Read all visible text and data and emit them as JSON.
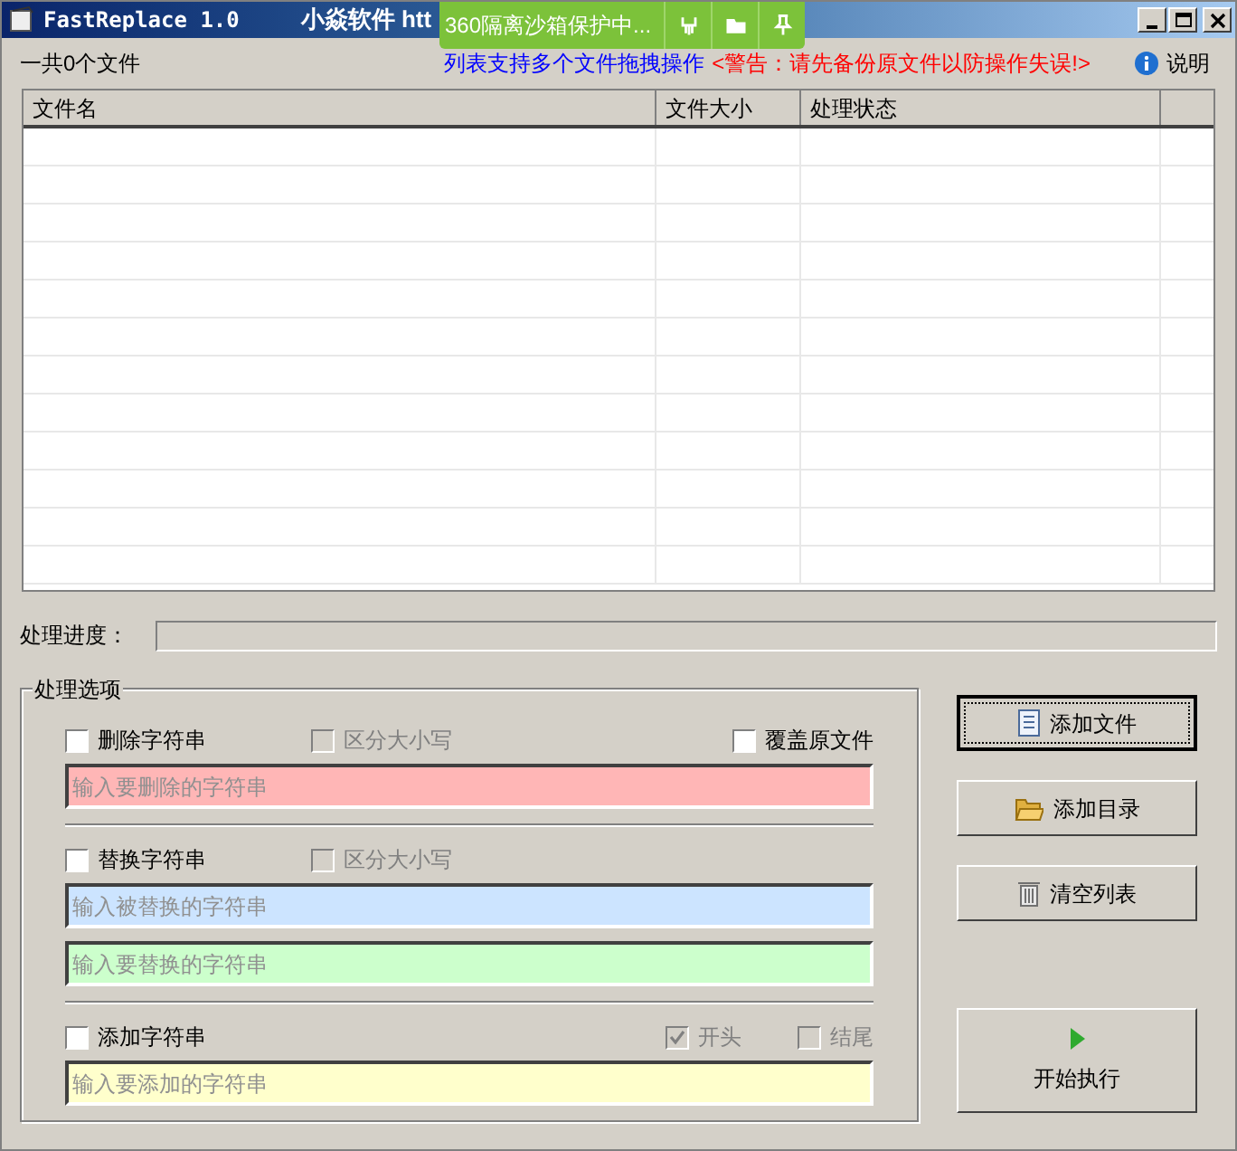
{
  "window": {
    "title": "FastReplace 1.0",
    "subtitle": "小焱软件 htt"
  },
  "sandbox_banner": {
    "text": "360隔离沙箱保护中..."
  },
  "file_count": "一共0个文件",
  "hint": "列表支持多个文件拖拽操作",
  "warning": "<警告：请先备份原文件以防操作失误!>",
  "help_link": "说明",
  "table": {
    "columns": [
      "文件名",
      "文件大小",
      "处理状态"
    ]
  },
  "progress": {
    "label": "处理进度：",
    "level": 0
  },
  "options": {
    "title": "处理选项",
    "sections": [
      {
        "checkboxes": [
          {
            "label": "删除字符串",
            "checked": false,
            "disabled": false
          },
          {
            "label": "区分大小写",
            "checked": false,
            "disabled": true
          },
          {
            "label": "覆盖原文件",
            "checked": false,
            "disabled": false
          }
        ],
        "fields": [
          {
            "placeholder": "输入要删除的字符串",
            "color": "#ffb6b6"
          }
        ]
      },
      {
        "checkboxes": [
          {
            "label": "替换字符串",
            "checked": false,
            "disabled": false
          },
          {
            "label": "区分大小写",
            "checked": false,
            "disabled": true
          }
        ],
        "fields": [
          {
            "placeholder": "输入被替换的字符串",
            "color": "#cce4ff"
          },
          {
            "placeholder": "输入要替换的字符串",
            "color": "#ccffcc"
          }
        ]
      },
      {
        "checkboxes": [
          {
            "label": "添加字符串",
            "checked": false,
            "disabled": false
          },
          {
            "label": "开头",
            "checked": true,
            "disabled": true
          },
          {
            "label": "结尾",
            "checked": false,
            "disabled": true
          }
        ],
        "fields": [
          {
            "placeholder": "输入要添加的字符串",
            "color": "#ffffcc"
          }
        ]
      }
    ]
  },
  "buttons": [
    {
      "label": "添加文件",
      "kind": "file",
      "focused": true
    },
    {
      "label": "添加目录",
      "kind": "folder",
      "focused": false
    },
    {
      "label": "清空列表",
      "kind": "trash",
      "focused": false
    },
    {
      "label": "开始执行",
      "kind": "run",
      "focused": false
    }
  ]
}
